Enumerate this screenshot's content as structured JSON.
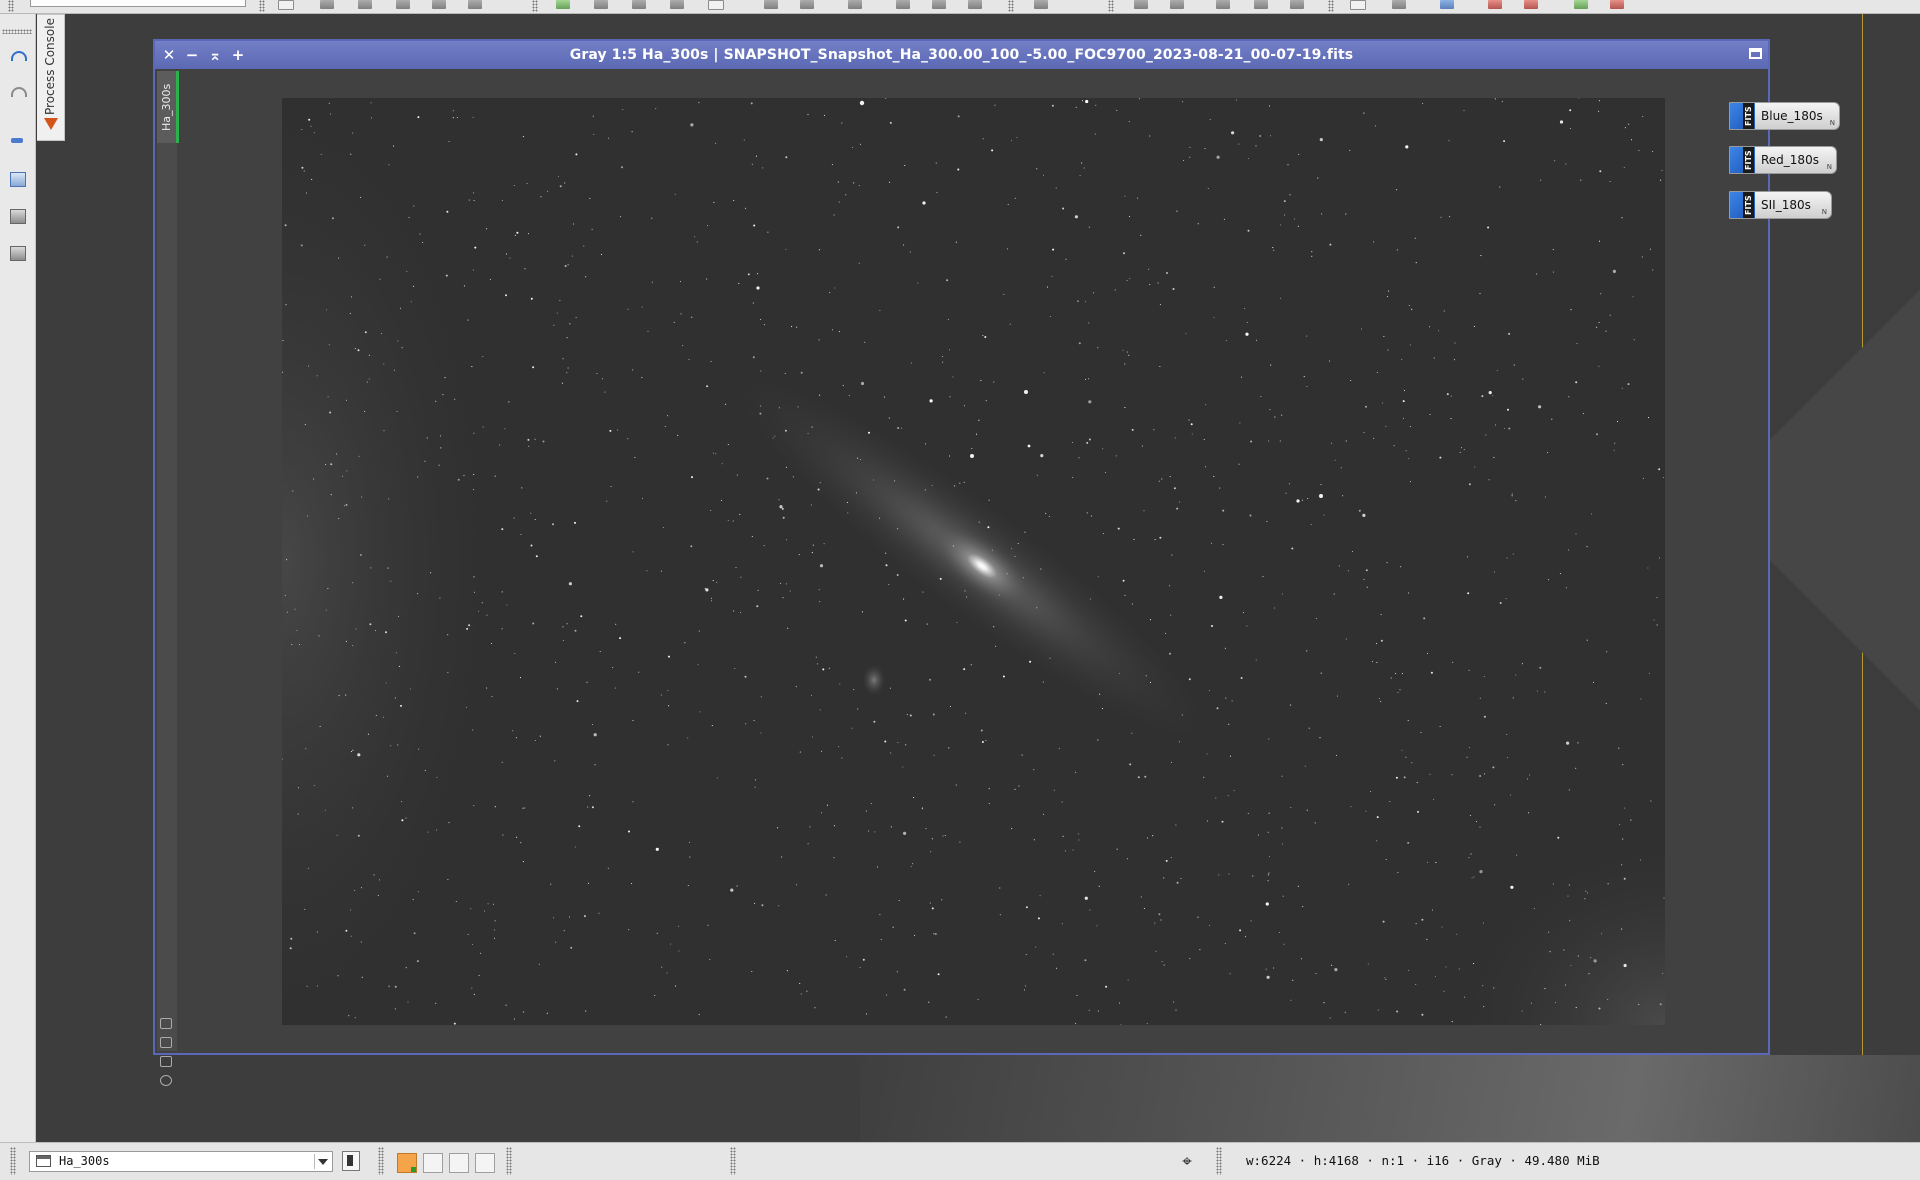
{
  "left_toolbar": {
    "process_console_label": "Process Console"
  },
  "image_window": {
    "title": "Gray 1:5 Ha_300s | SNAPSHOT_Snapshot_Ha_300.00_100_-5.00_FOC9700_2023-08-21_00-07-19.fits",
    "view_id": "Ha_300s",
    "buttons": {
      "close": "✕",
      "minimize": "−",
      "shade": "⌅",
      "maximize_glyph": "+"
    }
  },
  "desktop_icons": [
    {
      "label": "Blue_180s",
      "badge": "FITS",
      "corner": "N"
    },
    {
      "label": "Red_180s",
      "badge": "FITS",
      "corner": "N"
    },
    {
      "label": "SII_180s",
      "badge": "FITS",
      "corner": "N"
    }
  ],
  "bottom_bar": {
    "current_view": "Ha_300s",
    "image_info": "w:6224 · h:4168 · n:1 · i16 · Gray · 49.480 MiB",
    "crosshair_glyph": "⌖"
  },
  "colors": {
    "title_bar": "#6672bf",
    "view_tab_accent": "#2db24b",
    "swatch_active": "#f6a44a"
  },
  "icons": [
    "undo-icon",
    "redo-icon",
    "process-console-icon",
    "new-image-icon",
    "crosshair-icon",
    "fits-icon"
  ]
}
